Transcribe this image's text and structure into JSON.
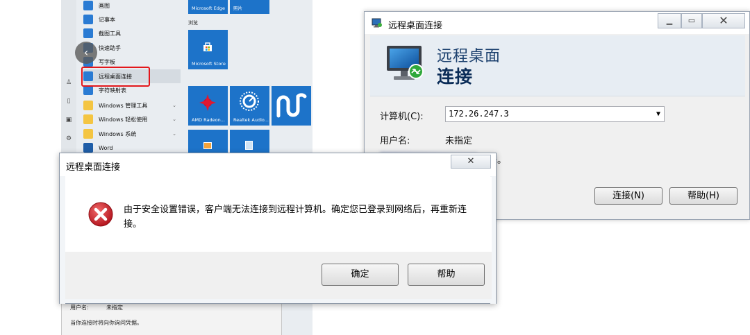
{
  "start_menu": {
    "apps": [
      {
        "label": "画图",
        "kind": "app"
      },
      {
        "label": "记事本",
        "kind": "app"
      },
      {
        "label": "截图工具",
        "kind": "app"
      },
      {
        "label": "快速助手",
        "kind": "app"
      },
      {
        "label": "写字板",
        "kind": "app"
      },
      {
        "label": "远程桌面连接",
        "kind": "app"
      },
      {
        "label": "字符映射表",
        "kind": "app"
      },
      {
        "label": "Windows 管理工具",
        "kind": "folder"
      },
      {
        "label": "Windows 轻松使用",
        "kind": "folder"
      },
      {
        "label": "Windows 系统",
        "kind": "folder"
      },
      {
        "label": "Word",
        "kind": "word"
      }
    ],
    "group_label": "浏览",
    "tiles": {
      "edge": "Microsoft Edge",
      "photos": "照片",
      "store": "Microsoft Store",
      "amd": "AMD Radeon...",
      "realtek": "Realtek Audio..."
    }
  },
  "rdp_window": {
    "title": "远程桌面连接",
    "banner_line1": "远程桌面",
    "banner_line2": "连接",
    "computer_label": "计算机(C):",
    "computer_value": "172.26.247.3",
    "username_label": "用户名:",
    "username_value": "未指定",
    "partial_text": "据。",
    "connect_button": "连接(N)",
    "help_button": "帮助(H)"
  },
  "behind_dialog": {
    "username_label": "用户名:",
    "username_value": "未指定",
    "hint": "当你连接时将向你询问凭据。"
  },
  "error_dialog": {
    "title": "远程桌面连接",
    "message": "由于安全设置错误，客户端无法连接到远程计算机。确定您已登录到网络后，再重新连接。",
    "ok_button": "确定",
    "help_button": "帮助",
    "close_glyph": "✕"
  },
  "colors": {
    "highlight_box": "#e3171b",
    "error_icon": "#c4161c",
    "banner_text": "#1a3f6d"
  }
}
